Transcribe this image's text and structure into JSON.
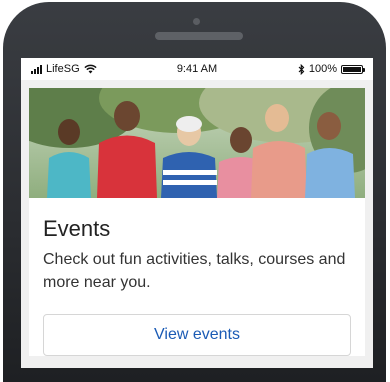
{
  "status_bar": {
    "carrier": "LifeSG",
    "time": "9:41 AM",
    "battery": "100%",
    "battery_level": 1.0
  },
  "card": {
    "title": "Events",
    "description": "Check out fun activities, talks, courses and more near you.",
    "button_label": "View events"
  },
  "colors": {
    "link": "#1b5bb5",
    "phone_body": "#2f3236"
  },
  "icons": [
    "signal-icon",
    "wifi-icon",
    "bluetooth-icon",
    "battery-icon"
  ]
}
